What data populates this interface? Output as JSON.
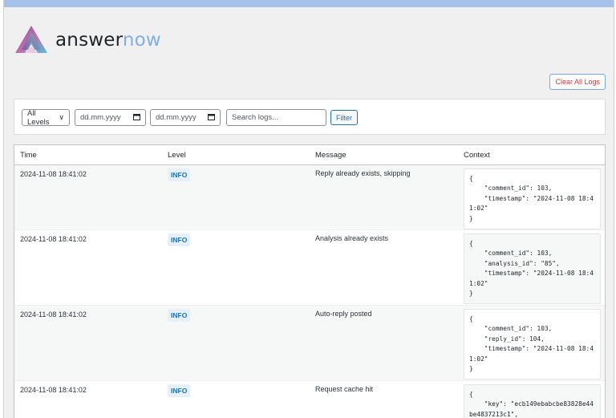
{
  "brand": {
    "name_part1": "answer",
    "name_part2": "now",
    "colors": {
      "accent": "#7fb0e3",
      "top_bar": "#a6c1ea",
      "danger": "#d63638",
      "primary": "#2271b1"
    }
  },
  "actions": {
    "clear_all_logs": "Clear All Logs"
  },
  "filters": {
    "level_select": "All Levels",
    "date_from_placeholder": "dd.mm.yyyy",
    "date_to_placeholder": "dd.mm.yyyy",
    "calendar_icon": "calendar-icon",
    "search_placeholder": "Search logs...",
    "filter_button": "Filter"
  },
  "table": {
    "headers": {
      "time": "Time",
      "level": "Level",
      "message": "Message",
      "context": "Context"
    },
    "rows": [
      {
        "time": "2024-11-08 18:41:02",
        "level": "INFO",
        "message": "Reply already exists, skipping",
        "context": "{\n    \"comment_id\": 103,\n    \"timestamp\": \"2024-11-08 18:41:02\"\n}"
      },
      {
        "time": "2024-11-08 18:41:02",
        "level": "INFO",
        "message": "Analysis already exists",
        "context": "{\n    \"comment_id\": 103,\n    \"analysis_id\": \"85\",\n    \"timestamp\": \"2024-11-08 18:41:02\"\n}"
      },
      {
        "time": "2024-11-08 18:41:02",
        "level": "INFO",
        "message": "Auto-reply posted",
        "context": "{\n    \"comment_id\": 103,\n    \"reply_id\": 104,\n    \"timestamp\": \"2024-11-08 18:41:02\"\n}"
      },
      {
        "time": "2024-11-08 18:41:02",
        "level": "INFO",
        "message": "Request cache hit",
        "context": "{\n    \"key\": \"ecb149ebabcbe83828e44be4837213c1\","
      }
    ]
  }
}
